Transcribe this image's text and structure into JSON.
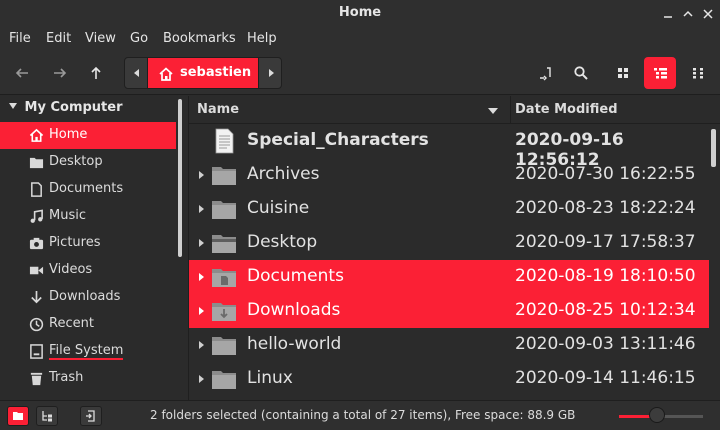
{
  "window": {
    "title": "Home"
  },
  "menu": [
    "File",
    "Edit",
    "View",
    "Go",
    "Bookmarks",
    "Help"
  ],
  "breadcrumb": {
    "current": "sebastien"
  },
  "sidebar": {
    "header": "My Computer",
    "items": [
      {
        "label": "Home",
        "icon": "home-icon",
        "active": true
      },
      {
        "label": "Desktop",
        "icon": "desktop-folder-icon"
      },
      {
        "label": "Documents",
        "icon": "document-icon"
      },
      {
        "label": "Music",
        "icon": "music-icon"
      },
      {
        "label": "Pictures",
        "icon": "camera-icon"
      },
      {
        "label": "Videos",
        "icon": "video-icon"
      },
      {
        "label": "Downloads",
        "icon": "download-icon"
      },
      {
        "label": "Recent",
        "icon": "clock-icon"
      },
      {
        "label": "File System",
        "icon": "file-system-icon"
      },
      {
        "label": "Trash",
        "icon": "trash-icon"
      }
    ]
  },
  "columns": {
    "name": "Name",
    "date": "Date Modified"
  },
  "files": [
    {
      "name": "Special_Characters",
      "date": "2020-09-16 12:56:12",
      "type": "file",
      "bold": true
    },
    {
      "name": "Archives",
      "date": "2020-07-30 16:22:55",
      "type": "folder"
    },
    {
      "name": "Cuisine",
      "date": "2020-08-23 18:22:24",
      "type": "folder"
    },
    {
      "name": "Desktop",
      "date": "2020-09-17 17:58:37",
      "type": "folder"
    },
    {
      "name": "Documents",
      "date": "2020-08-19 18:10:50",
      "type": "folder",
      "selected": true
    },
    {
      "name": "Downloads",
      "date": "2020-08-25 10:12:34",
      "type": "folder",
      "selected": true
    },
    {
      "name": "hello-world",
      "date": "2020-09-03 13:11:46",
      "type": "folder"
    },
    {
      "name": "Linux",
      "date": "2020-09-14 11:46:15",
      "type": "folder"
    }
  ],
  "status": {
    "text": "2 folders selected (containing a total of 27 items), Free space: 88.9 GB"
  },
  "zoom": {
    "level": 0.45
  },
  "colors": {
    "accent": "#fb2035",
    "background": "#2b2b2b",
    "chrome": "#2f2f2f"
  }
}
